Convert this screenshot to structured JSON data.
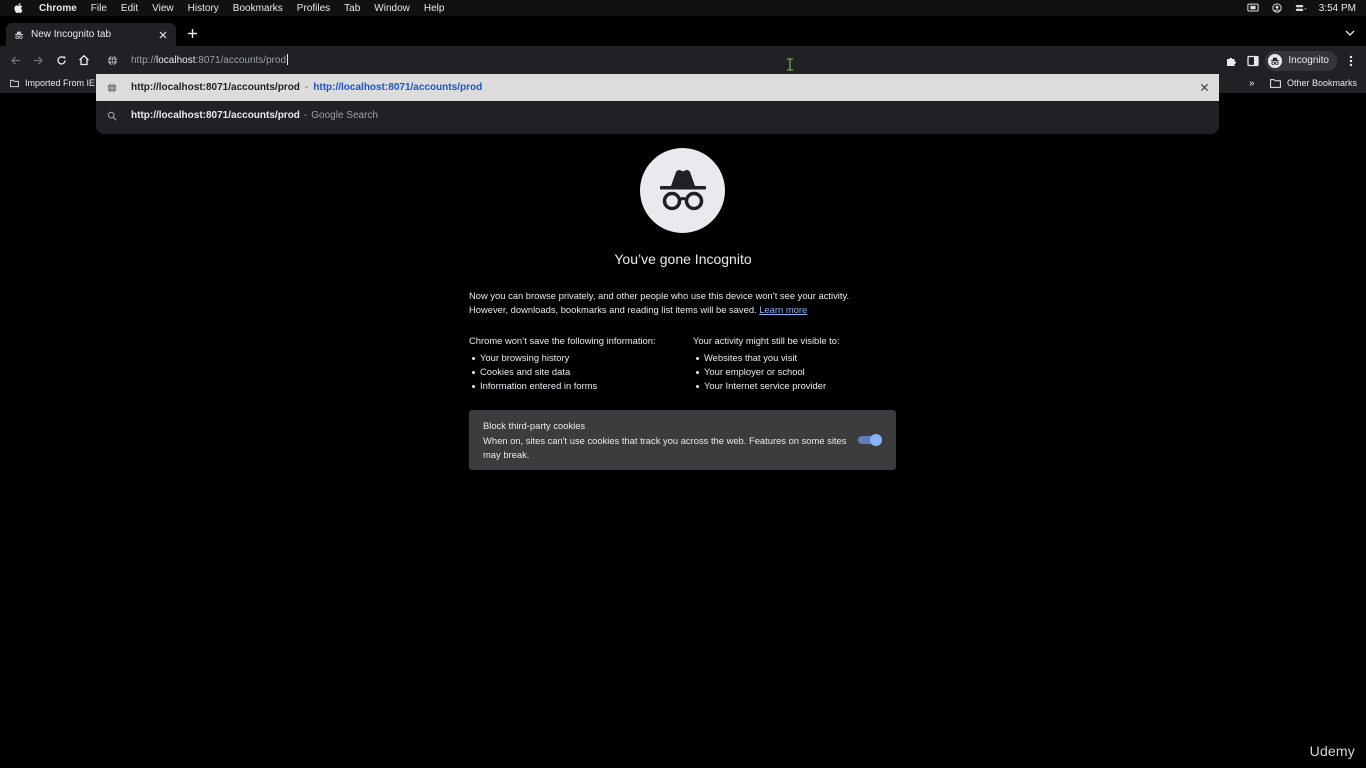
{
  "menubar": {
    "apple_icon": "apple-icon",
    "app_name": "Chrome",
    "items": [
      "File",
      "Edit",
      "View",
      "History",
      "Bookmarks",
      "Profiles",
      "Tab",
      "Window",
      "Help"
    ],
    "clock": "3:54 PM"
  },
  "tabs": {
    "active_title": "New Incognito tab"
  },
  "omnibox": {
    "url_prefix": "http://",
    "url_host": "localhost",
    "url_rest": ":8071/accounts/prod"
  },
  "toolbar": {
    "profile_label": "Incognito"
  },
  "bookmarks": {
    "imported": "Imported From IE",
    "other": "Other Bookmarks",
    "overflow": "»"
  },
  "suggestions": [
    {
      "text": "http://localhost:8071/accounts/prod",
      "separator": "-",
      "detail": "http://localhost:8071/accounts/prod"
    },
    {
      "text": "http://localhost:8071/accounts/prod",
      "separator": "-",
      "detail": "Google Search"
    }
  ],
  "ntp": {
    "title": "You’ve gone Incognito",
    "intro_line1": "Now you can browse privately, and other people who use this device won’t see your activity.",
    "intro_line2": "However, downloads, bookmarks and reading list items will be saved.",
    "learn_more": "Learn more",
    "left_heading_pre": "Chrome ",
    "left_heading_bold": "won’t save",
    "left_heading_post": " the following information:",
    "left_items": [
      "Your browsing history",
      "Cookies and site data",
      "Information entered in forms"
    ],
    "right_heading_pre": "Your activity ",
    "right_heading_bold": "might still be visible",
    "right_heading_post": " to:",
    "right_items": [
      "Websites that you visit",
      "Your employer or school",
      "Your Internet service provider"
    ],
    "cookie_title": "Block third-party cookies",
    "cookie_desc": "When on, sites can't use cookies that track you across the web. Features on some sites may break.",
    "cookie_toggle_on": true
  },
  "watermark": "Udemy",
  "colors": {
    "page_bg": "#000000",
    "chrome_bg": "#202124",
    "link": "#8ab4f8",
    "selected_suggestion_bg": "#dcdcdc",
    "suggestion_link": "#1a55c5",
    "toggle_knob": "#8ab4f8"
  }
}
